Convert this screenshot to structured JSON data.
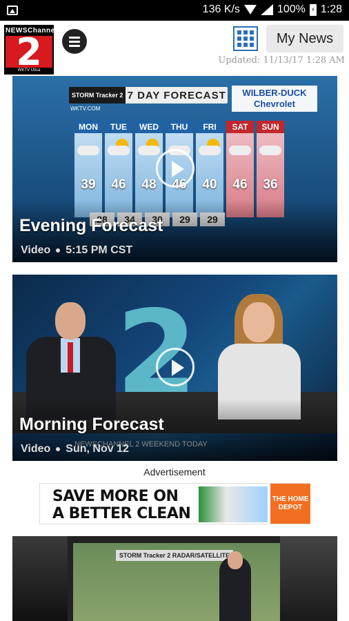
{
  "status_bar": {
    "speed": "136 K/s",
    "battery_percent": "100%",
    "time": "1:28"
  },
  "header": {
    "logo_top": "NEWSChannel",
    "logo_number": "2",
    "logo_bottom": "WKTV Utica",
    "my_news_label": "My News",
    "updated": "Updated: 11/13/17 1:28 AM"
  },
  "cards": [
    {
      "title": "Evening Forecast",
      "type": "Video",
      "time": "5:15 PM CST",
      "graphic": {
        "banner_brand": "STORM Tracker 2",
        "banner_title": "7 DAY FORECAST",
        "url": "WKTV.COM",
        "sponsor": "WILBER-DUCK Chevrolet",
        "days": [
          {
            "name": "MON",
            "high": "39",
            "weekend": false,
            "icon": "cloud-icon"
          },
          {
            "name": "TUE",
            "high": "46",
            "weekend": false,
            "icon": "partly-sunny-icon"
          },
          {
            "name": "WED",
            "high": "48",
            "weekend": false,
            "icon": "partly-sunny-icon"
          },
          {
            "name": "THU",
            "high": "46",
            "weekend": false,
            "icon": "cloud-icon"
          },
          {
            "name": "FRI",
            "high": "40",
            "weekend": false,
            "icon": "partly-sunny-icon"
          },
          {
            "name": "SAT",
            "high": "46",
            "weekend": true,
            "icon": "cloud-icon"
          },
          {
            "name": "SUN",
            "high": "36",
            "weekend": true,
            "icon": "cloud-icon"
          }
        ],
        "lows": [
          "28",
          "34",
          "30",
          "29",
          "29"
        ]
      }
    },
    {
      "title": "Morning Forecast",
      "type": "Video",
      "time": "Sun, Nov 12",
      "graphic": {
        "big_number": "2",
        "ticker": "NEWSCHANNEL 2 WEEKEND TODAY"
      }
    },
    {
      "graphic": {
        "banner": "STORM Tracker 2 RADAR/SATELLITE"
      }
    }
  ],
  "advertisement": {
    "label": "Advertisement",
    "headline_line1": "SAVE MORE ON",
    "headline_line2": "A BETTER CLEAN",
    "brand": "THE HOME DEPOT"
  },
  "colors": {
    "brand_red": "#d71920",
    "accent_blue": "#2a6fb8",
    "home_depot_orange": "#f26f21"
  }
}
